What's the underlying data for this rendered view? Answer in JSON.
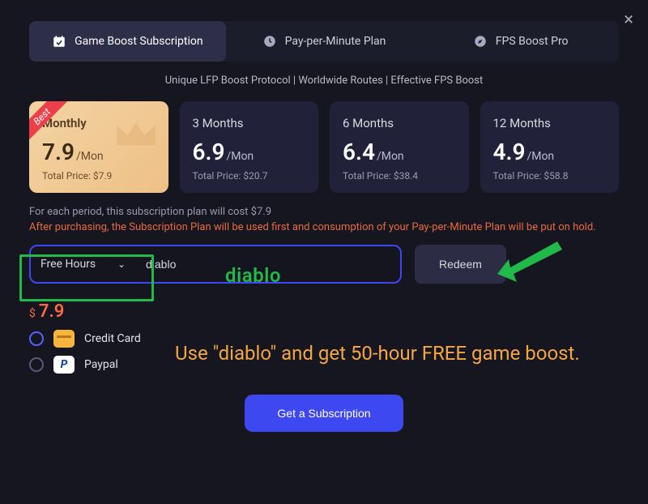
{
  "close_label": "×",
  "tabs": [
    {
      "label": "Game Boost Subscription",
      "icon": "calendar-check-icon"
    },
    {
      "label": "Pay-per-Minute Plan",
      "icon": "clock-icon"
    },
    {
      "label": "FPS Boost Pro",
      "icon": "compass-icon"
    }
  ],
  "subheading": "Unique LFP Boost Protocol | Worldwide Routes | Effective FPS Boost",
  "best_ribbon": "Best",
  "plans": [
    {
      "title": "Monthly",
      "price": "7.9",
      "unit": "/Mon",
      "total_label": "Total Price: $7.9"
    },
    {
      "title": "3 Months",
      "price": "6.9",
      "unit": "/Mon",
      "total_label": "Total Price: $20.7"
    },
    {
      "title": "6 Months",
      "price": "6.4",
      "unit": "/Mon",
      "total_label": "Total Price: $38.4"
    },
    {
      "title": "12 Months",
      "price": "4.9",
      "unit": "/Mon",
      "total_label": "Total Price: $58.8"
    }
  ],
  "period_note": "For each period, this subscription plan will cost $7.9",
  "warning": "After purchasing, the Subscription Plan will be used first and consumption of your Pay-per-Minute Plan will be put on hold.",
  "redeem": {
    "type_label": "Free Hours",
    "code_value": "diablo",
    "button": "Redeem"
  },
  "cost": {
    "currency": "$",
    "price": "7.9"
  },
  "pay_methods": [
    {
      "label": "Credit Card",
      "icon": "credit-card-icon"
    },
    {
      "label": "Paypal",
      "icon": "paypal-icon"
    }
  ],
  "cta": "Get a Subscription",
  "annotation": {
    "code_echo": "diablo",
    "message": "Use \"diablo\" and get 50-hour FREE game boost."
  }
}
